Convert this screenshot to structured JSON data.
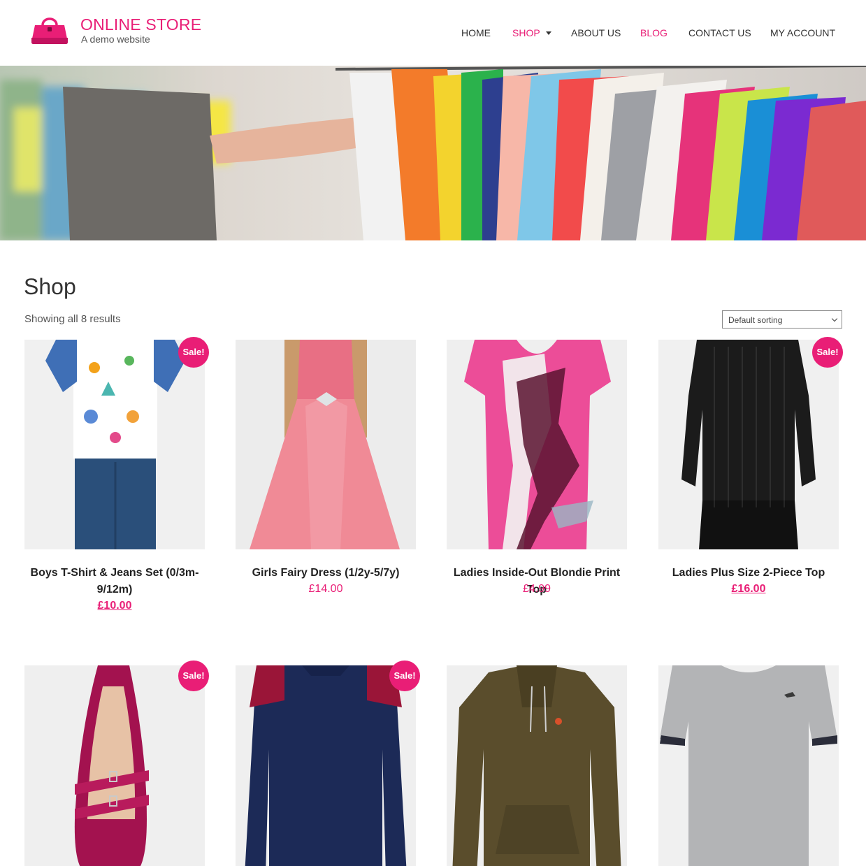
{
  "brand": {
    "title": "ONLINE STORE",
    "tagline": "A demo website",
    "logo_icon": "handbag-icon",
    "accent_color": "#e91e76"
  },
  "nav": [
    {
      "label": "HOME",
      "active": false
    },
    {
      "label": "SHOP",
      "active": true,
      "has_dropdown": true
    },
    {
      "label": "ABOUT US",
      "active": false
    },
    {
      "label": "BLOG",
      "active": true
    },
    {
      "label": "CONTACT US",
      "active": false
    },
    {
      "label": "MY ACCOUNT",
      "active": false
    }
  ],
  "page": {
    "title": "Shop",
    "result_count": "Showing all 8 results",
    "sorting_selected": "Default sorting"
  },
  "sale_label": "Sale!",
  "products": [
    {
      "name": "Boys T-Shirt & Jeans Set (0/3m-9/12m)",
      "price": "£10.00",
      "on_sale": true
    },
    {
      "name": "Girls Fairy Dress (1/2y-5/7y)",
      "price": "£14.00",
      "on_sale": false
    },
    {
      "name": "Ladies Inside-Out Blondie Print Top",
      "price": "£4.99",
      "on_sale": false
    },
    {
      "name": "Ladies Plus Size 2-Piece Top",
      "price": "£16.00",
      "on_sale": true
    },
    {
      "name": "",
      "price": "",
      "on_sale": true
    },
    {
      "name": "",
      "price": "",
      "on_sale": true
    },
    {
      "name": "",
      "price": "",
      "on_sale": false
    },
    {
      "name": "",
      "price": "",
      "on_sale": false
    }
  ]
}
